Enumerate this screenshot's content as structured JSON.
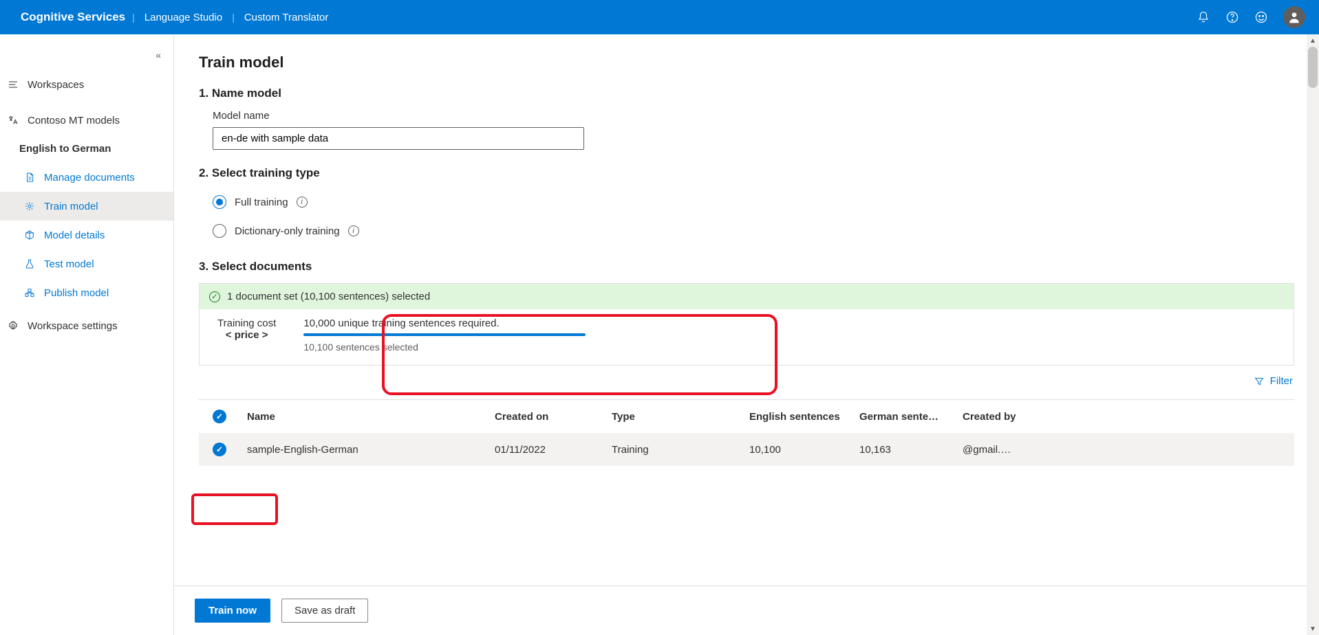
{
  "header": {
    "brand": "Cognitive Services",
    "crumbs": [
      "Language Studio",
      "Custom Translator"
    ]
  },
  "sidebar": {
    "workspaces": "Workspaces",
    "project_group": "Contoso MT models",
    "project": "English to German",
    "items": [
      {
        "label": "Manage documents"
      },
      {
        "label": "Train model"
      },
      {
        "label": "Model details"
      },
      {
        "label": "Test model"
      },
      {
        "label": "Publish model"
      }
    ],
    "settings": "Workspace settings"
  },
  "main": {
    "title": "Train model",
    "step1": {
      "heading": "1. Name model",
      "label": "Model name",
      "value": "en-de with sample data"
    },
    "step2": {
      "heading": "2. Select training type",
      "opt1": "Full training",
      "opt2": "Dictionary-only training"
    },
    "step3": {
      "heading": "3. Select documents",
      "banner": "1 document set (10,100 sentences) selected",
      "cost_label": "Training cost",
      "cost_value": "< price >",
      "required": "10,000 unique training sentences required.",
      "selected": "10,100 sentences selected",
      "filter": "Filter"
    },
    "table": {
      "cols": [
        "Name",
        "Created on",
        "Type",
        "English sentences",
        "German sente…",
        "Created by"
      ],
      "row": {
        "name": "sample-English-German",
        "created": "01/11/2022",
        "type": "Training",
        "en": "10,100",
        "de": "10,163",
        "by": "@gmail.…"
      }
    },
    "buttons": {
      "train": "Train now",
      "draft": "Save as draft"
    }
  }
}
